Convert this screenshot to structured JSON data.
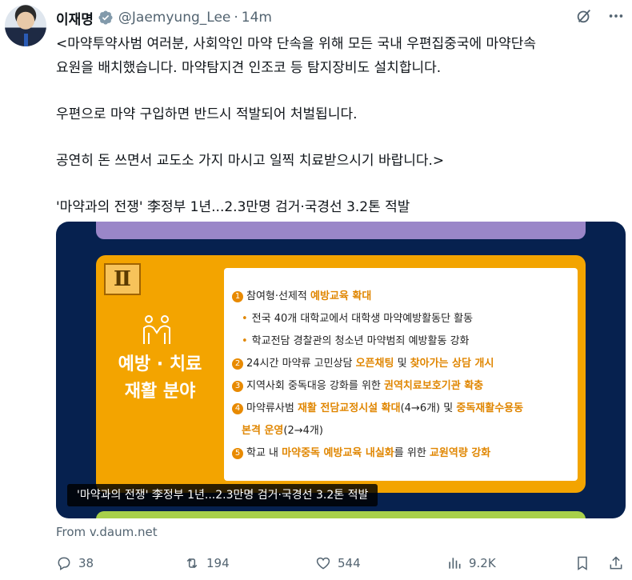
{
  "author": {
    "name": "이재명",
    "handle": "@Jaemyung_Lee",
    "separator": "·",
    "time": "14m"
  },
  "tweet": {
    "lines": [
      "<마약투약사범 여러분, 사회악인 마약 단속을 위해 모든 국내 우편집중국에 마약단속",
      "요원을 배치했습니다. 마약탐지견 인조코 등 탐지장비도 설치합니다.",
      "우편으로 마약 구입하면 반드시 적발되어 처벌됩니다.",
      "공연히 돈 쓰면서 교도소 가지 마시고 일찍 치료받으시기 바랍니다.>",
      "'마약과의 전쟁' 李정부 1년...2.3만명 검거·국경선 3.2톤 적발"
    ]
  },
  "media": {
    "roman_numeral": "Ⅱ",
    "section_title_line1": "예방 · 치료",
    "section_title_line2": "재활 분야",
    "items": [
      {
        "num": "1",
        "pre": "참여형·선제적 ",
        "hl": "예방교육 확대",
        "post": ""
      },
      {
        "bullet": "•",
        "text": "전국 40개 대학교에서 대학생 마약예방활동단 활동"
      },
      {
        "bullet": "•",
        "text": "학교전담 경찰관의 청소년 마약범죄 예방활동 강화"
      },
      {
        "num": "2",
        "pre": "24시간 마약류 고민상담 ",
        "hl": "오픈채팅",
        "mid": " 및 ",
        "hl2": "찾아가는 상담 개시"
      },
      {
        "num": "3",
        "pre": "지역사회 중독대응 강화를 위한 ",
        "hl": "권역치료보호기관 확충",
        "post": ""
      },
      {
        "num": "4",
        "pre": "마약류사범 ",
        "hl": "재활 전담교정시설 확대",
        "mid": "(4→6개) 및 ",
        "hl2": "중독재활수용동"
      },
      {
        "hl": "본격 운영",
        "post": "(2→4개)"
      },
      {
        "num": "5",
        "pre": "학교 내 ",
        "hl": "마약중독 예방교육 내실화",
        "mid": "를 위한 ",
        "hl2": "교원역량 강화"
      }
    ],
    "caption": "'마약과의 전쟁' 李정부 1년...2.3만명 검거·국경선 3.2톤 적발",
    "colors": {
      "navy": "#06214f",
      "orange": "#f3a400",
      "highlight": "#e08600",
      "purple": "#9a86c8",
      "green": "#a8d04a"
    }
  },
  "source": "From v.daum.net",
  "actions": {
    "replies": "38",
    "reposts": "194",
    "likes": "544",
    "views": "9.2K"
  },
  "icons": [
    "verified-badge-icon",
    "grok-icon",
    "more-icon",
    "reply-icon",
    "repost-icon",
    "like-icon",
    "views-icon",
    "bookmark-icon",
    "share-icon"
  ]
}
